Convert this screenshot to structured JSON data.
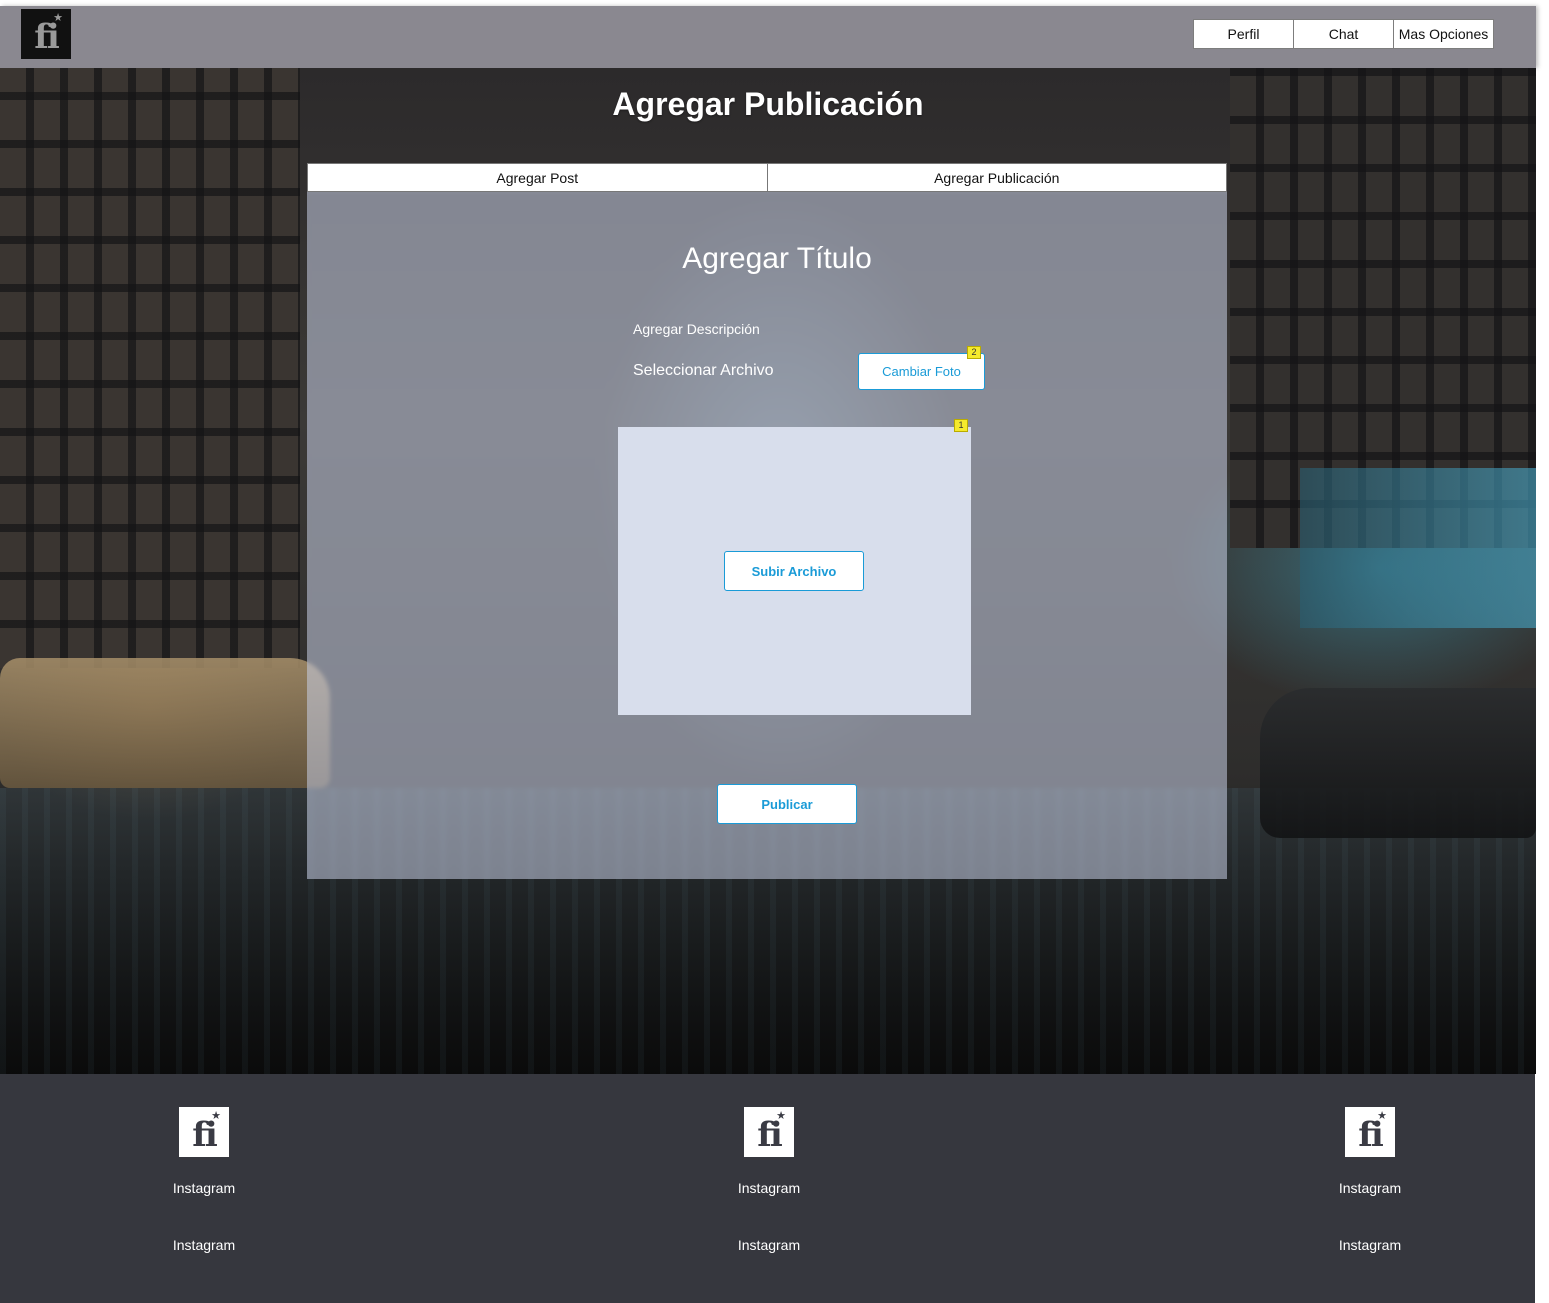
{
  "header": {
    "logo_icon": "fi-star-logo",
    "nav": [
      "Perfil",
      "Chat",
      "Mas Opciones"
    ]
  },
  "page": {
    "title": "Agregar Publicación"
  },
  "tabs": [
    "Agregar Post",
    "Agregar Publicación"
  ],
  "form": {
    "title": "Agregar Título",
    "description_label": "Agregar Descripción",
    "file_label": "Seleccionar Archivo",
    "change_photo_button": "Cambiar Foto",
    "change_photo_badge": "2",
    "upload_badge": "1",
    "upload_button": "Subir Archivo",
    "publish_button": "Publicar"
  },
  "footer": {
    "columns": [
      {
        "links": [
          "Instagram",
          "Instagram"
        ]
      },
      {
        "links": [
          "Instagram",
          "Instagram"
        ]
      },
      {
        "links": [
          "Instagram",
          "Instagram"
        ]
      }
    ]
  },
  "colors": {
    "topbar": "#8a8890",
    "accent": "#1a9bd7",
    "footer": "#36373e",
    "panel": "#c8d0e6"
  }
}
